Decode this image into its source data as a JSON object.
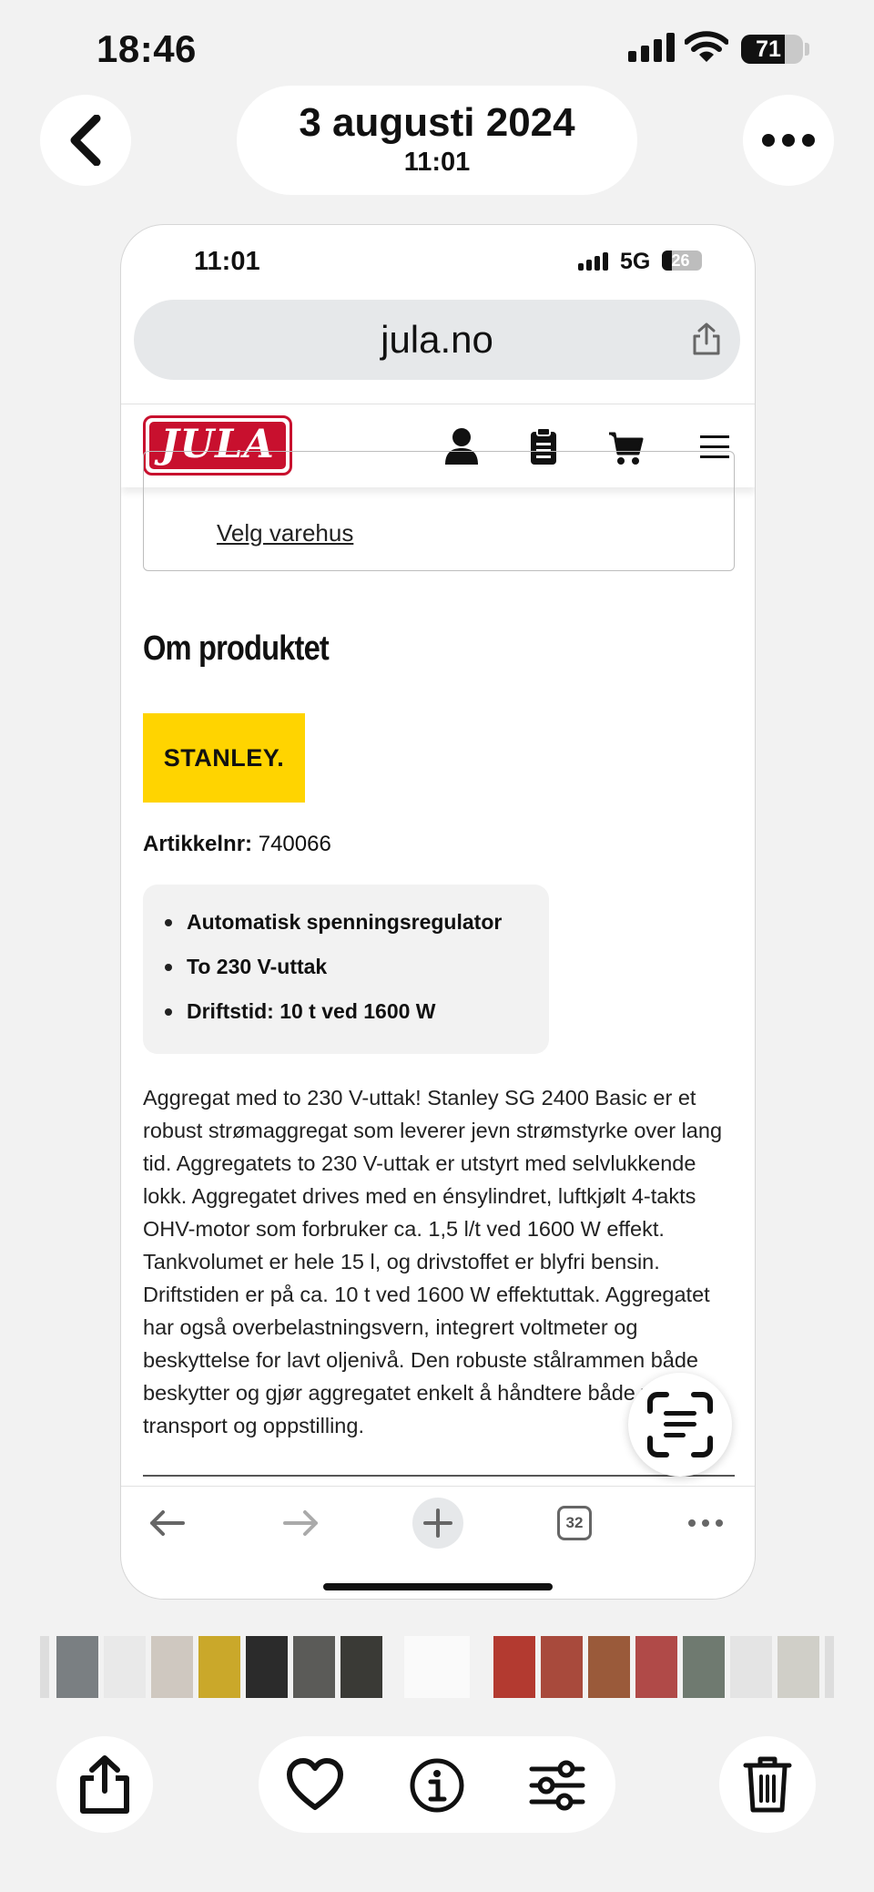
{
  "status_bar": {
    "time": "18:46",
    "battery": "71"
  },
  "header": {
    "date": "3 augusti 2024",
    "time": "11:01"
  },
  "browser": {
    "status": {
      "time": "11:01",
      "network": "5G",
      "battery": "26"
    },
    "url": "jula.no",
    "tab_count": "32"
  },
  "site": {
    "logo_text": "JULA",
    "store_link": "Velg varehus",
    "section_title": "Om produktet",
    "brand_logo_text": "STANLEY.",
    "article_label": "Artikkelnr:",
    "article_number": "740066",
    "features": [
      "Automatisk spenningsregulator",
      "To 230 V-uttak",
      "Driftstid: 10 t ved 1600 W"
    ],
    "description": "Aggregat med to 230 V-uttak! Stanley SG 2400 Basic er et robust strømaggregat som leverer jevn strømstyrke over lang tid. Aggregatets to 230 V-uttak er utstyrt med selvlukkende lokk. Aggregatet drives med en énsylindret, luftkjølt 4-takts OHV-motor som forbruker ca. 1,5 l/t ved 1600 W effekt. Tankvolumet er hele 15 l, og drivstoffet er blyfri bensin. Driftstiden er på ca. 10 t ved 1600 W effektuttak. Aggregatet har også overbelastningsvern, integrert voltmeter og beskyttelse for lavt oljenivå. Den robuste stålrammen både beskytter og gjør aggregatet enkelt å håndtere både ved transport og oppstilling."
  },
  "colors": {
    "jula_red": "#c8102e",
    "stanley_yellow": "#ffd400",
    "background": "#f2f2f2"
  },
  "icons": [
    "chevron-left-icon",
    "ellipsis-icon",
    "share-icon",
    "user-icon",
    "clipboard-icon",
    "cart-icon",
    "menu-icon",
    "arrow-left-icon",
    "arrow-right-icon",
    "plus-icon",
    "live-text-icon",
    "heart-icon",
    "info-icon",
    "sliders-icon",
    "trash-icon"
  ]
}
